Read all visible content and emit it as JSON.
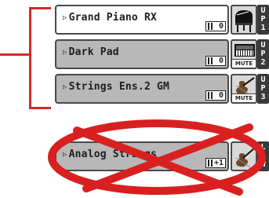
{
  "bracket_color": "#d12b2b",
  "tracks": [
    {
      "name": "Grand Piano RX",
      "octave": "0",
      "icon": "grand-piano-icon",
      "muted": false,
      "mute_label": "",
      "tag": [
        "U",
        "P",
        "1"
      ],
      "selected": true
    },
    {
      "name": "Dark Pad",
      "octave": "0",
      "icon": "synth-keyboard-icon",
      "muted": true,
      "mute_label": "MUTE",
      "tag": [
        "U",
        "P",
        "2"
      ],
      "selected": false
    },
    {
      "name": "Strings Ens.2 GM",
      "octave": "0",
      "icon": "violin-icon",
      "muted": true,
      "mute_label": "MUTE",
      "tag": [
        "U",
        "P",
        "3"
      ],
      "selected": false
    },
    {
      "name": "Analog Strings",
      "octave": "+1",
      "icon": "violin-icon",
      "muted": false,
      "mute_label": "",
      "tag": [
        "L",
        "O",
        "W"
      ],
      "selected": false
    }
  ],
  "prohibited_track_index": 3,
  "prohibition_color": "#d92020"
}
